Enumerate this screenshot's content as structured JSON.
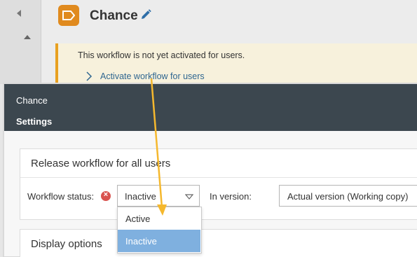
{
  "header": {
    "title": "Chance"
  },
  "notice": {
    "message": "This workflow is not yet activated for users.",
    "link_label": "Activate workflow for users"
  },
  "dialog": {
    "title": "Chance",
    "subtitle": "Settings"
  },
  "release_section": {
    "title": "Release workflow for all users",
    "status_label": "Workflow status:",
    "status_value": "Inactive",
    "status_options": [
      "Active",
      "Inactive"
    ],
    "selected_option": "Inactive",
    "version_label": "In version:",
    "version_value": "Actual version (Working copy)"
  },
  "display_section": {
    "title": "Display options"
  },
  "colors": {
    "accent_orange": "#e08a1e",
    "dialog_header": "#3c474f",
    "link_blue": "#2f6690",
    "selected_option": "#7fb0df",
    "error_red": "#d9534f",
    "annotation_arrow": "#f5b82e"
  },
  "icons": {
    "workflow": "workflow-tag-icon",
    "edit": "pencil-icon",
    "error": "error-circle-icon",
    "link_chevron": "chevron-right-icon",
    "select_caret": "caret-down-icon"
  }
}
